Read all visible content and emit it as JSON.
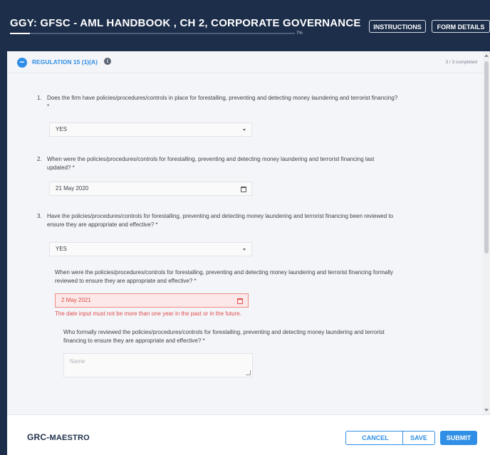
{
  "header": {
    "title": "GGY: GFSC - AML HANDBOOK , CH 2, CORPORATE GOVERNANCE",
    "progress_percent": 7,
    "progress_label": "7%",
    "instructions_label": "INSTRUCTIONS",
    "form_details_label": "FORM DETAILS"
  },
  "section": {
    "title": "REGULATION 15 (1)(A)",
    "completed": "3 / 3 completed"
  },
  "questions": [
    {
      "number": "1.",
      "text_line1": "Does the firm have policies/procedures/controls in place for forestalling, preventing and detecting money laundering and terrorist financing?",
      "text_line2": "*",
      "answer": "YES"
    },
    {
      "number": "2.",
      "text_line1": "When were the policies/procedures/controls for forestalling, preventing and detecting money laundering and terrorist financing last",
      "text_line2": "updated? *",
      "answer": "21 May 2020"
    },
    {
      "number": "3.",
      "text_line1": "Have the policies/procedures/controls for forestalling, preventing and detecting money laundering and terrorist financing been reviewed to",
      "text_line2": "ensure they are appropriate and effective? *",
      "answer": "YES"
    }
  ],
  "subquestion": {
    "text_line1": "When were the policies/procedures/controls for forestalling, preventing and detecting money laundering and terrorist financing formally",
    "text_line2": "reviewed to ensure they are appropriate and effective? *",
    "answer": "2 May 2021",
    "error": "The date input must not be more than one year in the past or in the future."
  },
  "subsubquestion": {
    "text_line1": "Who formally reviewed the policies/procedures/controls for forestalling, preventing and detecting money laundering and terrorist",
    "text_line2": "financing to ensure they are appropriate and effective? *",
    "placeholder": "Name"
  },
  "footer": {
    "logo_part1": "GRC-",
    "logo_part2": "MAESTRO",
    "cancel_label": "CANCEL",
    "save_label": "SAVE",
    "submit_label": "SUBMIT"
  },
  "colors": {
    "header_bg": "#1c2e4a",
    "accent": "#2f8ee6",
    "error": "#e04c4c"
  }
}
